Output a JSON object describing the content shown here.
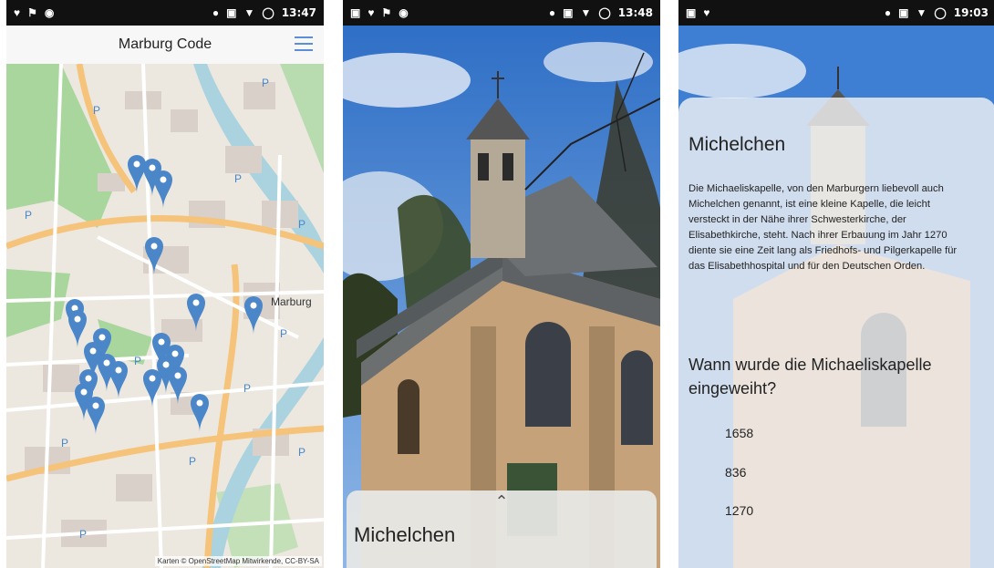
{
  "screens": [
    {
      "status": {
        "time": "13:47"
      },
      "app_title": "Marburg Code",
      "map": {
        "labels": [
          "Marburg"
        ],
        "attribution": "Karten © OpenStreetMap Mitwirkende, CC-BY-SA"
      }
    },
    {
      "status": {
        "time": "13:48"
      },
      "sheet_title": "Michelchen"
    },
    {
      "status": {
        "time": "19:03"
      },
      "title": "Michelchen",
      "description": "Die Michaeliskapelle, von den Marburgern liebevoll auch Michelchen genannt, ist eine kleine Kapelle, die leicht versteckt in der Nähe ihrer Schwesterkirche, der Elisabethkirche, steht. Nach ihrer Erbauung im Jahr 1270 diente sie eine Zeit lang als Friedhofs- und Pilgerkapelle für das Elisabethhospital und für den Deutschen Orden.",
      "question": "Wann wurde die Michaeliskapelle eingeweiht?",
      "answers": [
        "1658",
        "836",
        "1270"
      ]
    }
  ],
  "colors": {
    "pin": "#4a86c8",
    "park": "#a8d69c",
    "road": "#f5c37a",
    "sky": "#3e7fd3"
  }
}
